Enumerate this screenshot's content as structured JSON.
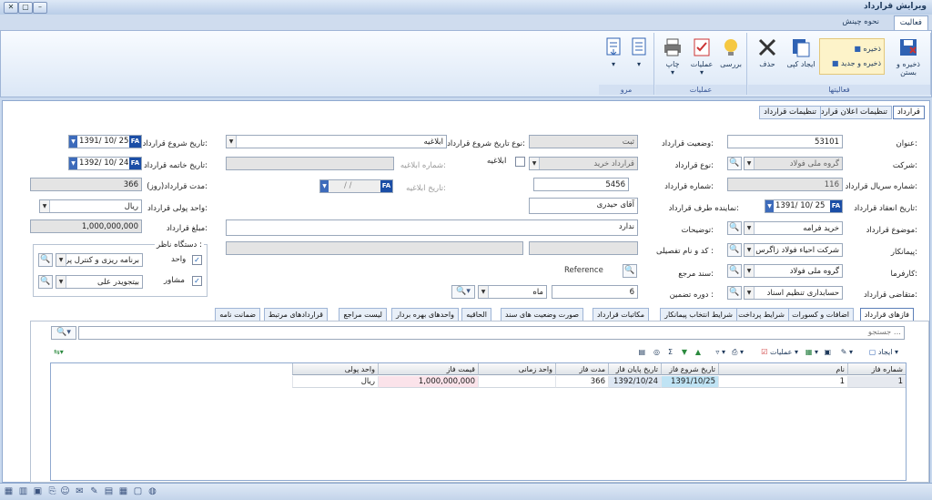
{
  "window": {
    "title": "ویرایش قرارداد"
  },
  "ribbon_tabs": [
    "فعالیت",
    "نحوه چینش"
  ],
  "ribbon": {
    "save_close": "ذخیره و بستن",
    "save": "ذخیره",
    "save_new": "ذخیره و جدید",
    "create_copy": "ایجاد کپی",
    "delete": "حذف",
    "activities_group": "فعالیتها",
    "review": "بررسی",
    "operations": "عملیات",
    "print": "چاپ",
    "operations_group": "عملیات",
    "related_group": "مرو"
  },
  "form_tabs": [
    "قرارداد",
    "تنظیمات اعلان قرارداد",
    "تنظیمات قرارداد"
  ],
  "form": {
    "title_label": "عنوان:",
    "title_value": "53101",
    "company_label": "شرکت:",
    "company_value": "گروه ملی فولاد",
    "serial_label": "شماره سریال قرارداد:",
    "serial_value": "116",
    "conclusion_date_label": "تاریخ انعقاد قرارداد:",
    "conclusion_date": "1391/ 10/ 25",
    "subject_label": "موضوع قرارداد:",
    "subject_value": "خرید فرامه",
    "contractor_label": "پیمانکار:",
    "contractor_value": "شرکت احیاء فولاد زاگرس",
    "employer_label": "کارفرما:",
    "employer_value": "گروه ملی فولاد",
    "applicant_label": "متقاضی قرارداد:",
    "applicant_value": "حسابداری تنظیم اسناد",
    "status_label": "وضعیت قرارداد:",
    "status_value": "ثبت",
    "type_label": "نوع قرارداد:",
    "type_value": "قرارداد خرید",
    "number_label": "شماره قرارداد:",
    "number_value": "5456",
    "rep_label": "نماینده طرف قرارداد:",
    "rep_value": "آقای حیدری",
    "desc_label": "توضیحات:",
    "desc_value": "ندارد",
    "detail_label": "کد و نام تفصیلی :",
    "ref_doc_label": "سند مرجع:",
    "ref_doc_value": "Reference",
    "guarantee_label": "دوره تضمین :",
    "guarantee_value": "6",
    "guarantee_unit": "ماه",
    "start_type_label": "نوع تاریخ شروع قرارداد:",
    "start_type_value": "ابلاغیه",
    "notice_chk_label": "ابلاغیه",
    "notice_no_label": "شماره ابلاغیه:",
    "notice_date_label": "تاریخ ابلاغیه:",
    "notice_date": "/ /",
    "start_date_label": "تاریخ شروع قرارداد:",
    "start_date": "1391/ 10/ 25",
    "end_date_label": "تاریخ خاتمه قرارداد:",
    "end_date": "1392/ 10/ 24",
    "duration_label": "مدت قرارداد(روز):",
    "duration_value": "366",
    "currency_label": "واحد پولی قرارداد:",
    "currency_value": "ریال",
    "amount_label": "مبلغ قرارداد:",
    "amount_value": "1,000,000,000",
    "supervisor_title": "دستگاه ناظر :",
    "unit_label": "واحد",
    "unit_value": "برنامه ریزی و کنترل پروژ",
    "advisor_label": "مشاور",
    "advisor_value": "بیتجویدر علی"
  },
  "sub_tabs": [
    "فازهای قرارداد",
    "اضافات و کسورات",
    "شرایط پرداخت",
    "شرایط انتخاب پیمانکار",
    "مکاتبات قرارداد",
    "صورت وضعیت های سند",
    "الحاقیه",
    "واحدهای بهره بردار",
    "لیست مراجع",
    "قراردادهای مرتبط",
    "ضمانت نامه"
  ],
  "search": {
    "placeholder": "جستجو ..."
  },
  "toolbar": {
    "create": "ایجاد",
    "operations": "عملیات"
  },
  "grid": {
    "columns": [
      "شماره فاز",
      "نام",
      "تاریخ شروع فاز",
      "تاریخ پایان فاز",
      "مدت فاز",
      "واحد زمانی",
      "قیمت فاز",
      "واحد پولی"
    ],
    "rows": [
      [
        "1",
        "1",
        "1391/10/25",
        "1392/10/24",
        "366",
        "",
        "1,000,000,000",
        "ریال"
      ]
    ]
  }
}
